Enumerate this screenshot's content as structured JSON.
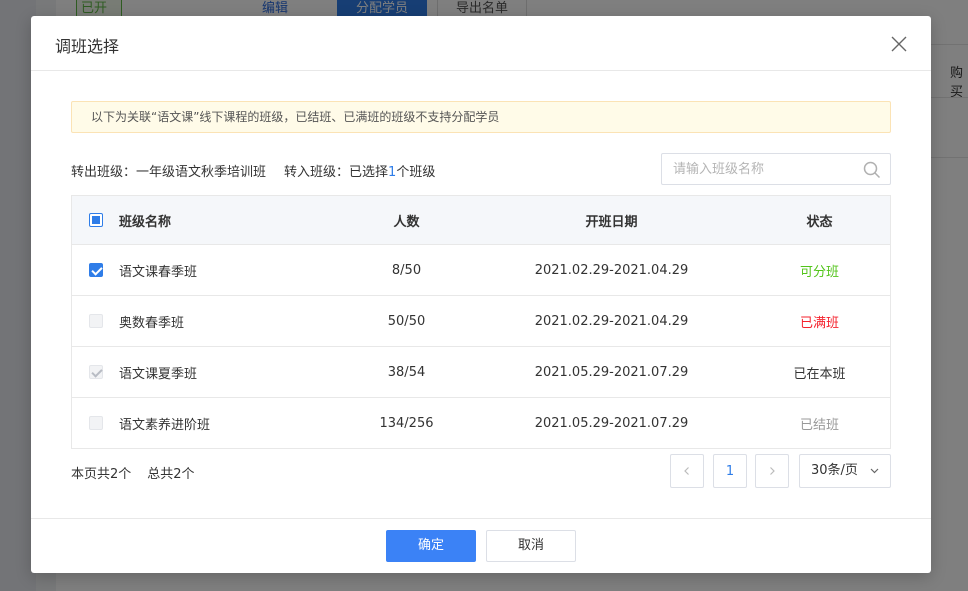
{
  "background": {
    "tag_status": "已开班",
    "link_edit": "编辑",
    "btn_assign": "分配学员",
    "btn_export": "导出名单",
    "side_text": "购买"
  },
  "modal": {
    "title": "调班选择",
    "notice": "以下为关联“语文课”线下课程的班级，已结班、已满班的班级不支持分配学员",
    "transfer_out_label": "转出班级：",
    "transfer_out_value": "一年级语文秋季培训班",
    "transfer_in_label": "转入班级：已选择",
    "transfer_in_count": "1",
    "transfer_in_suffix": "个班级",
    "search_placeholder": "请输入班级名称",
    "table": {
      "headers": {
        "name": "班级名称",
        "count": "人数",
        "date": "开班日期",
        "status": "状态"
      },
      "rows": [
        {
          "name": "语文课春季班",
          "count": "8/50",
          "date": "2021.02.29-2021.04.29",
          "status": "可分班",
          "status_color": "#52c41a",
          "check": "checked"
        },
        {
          "name": "奥数春季班",
          "count": "50/50",
          "date": "2021.02.29-2021.04.29",
          "status": "已满班",
          "status_color": "#f5222d",
          "check": "disabled"
        },
        {
          "name": "语文课夏季班",
          "count": "38/54",
          "date": "2021.05.29-2021.07.29",
          "status": "已在本班",
          "status_color": "#333333",
          "check": "disabled-checked"
        },
        {
          "name": "语文素养进阶班",
          "count": "134/256",
          "date": "2021.05.29-2021.07.29",
          "status": "已结班",
          "status_color": "#999999",
          "check": "disabled"
        }
      ]
    },
    "pagination": {
      "page_count_text": "本页共2个",
      "total_text": "总共2个",
      "current_page": "1",
      "page_size": "30条/页"
    },
    "footer": {
      "confirm": "确定",
      "cancel": "取消"
    }
  }
}
